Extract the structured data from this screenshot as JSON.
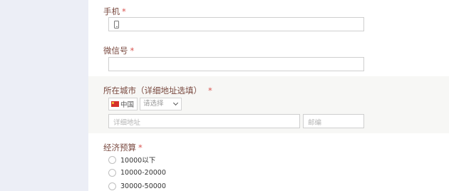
{
  "form": {
    "phone": {
      "label": "手机",
      "required_mark": "*",
      "icon": "mobile-phone-icon"
    },
    "wechat": {
      "label": "微信号",
      "required_mark": "*"
    },
    "city": {
      "label": "所在城市（详细地址选填）",
      "required_mark": "*",
      "country": "中国",
      "region_placeholder": "请选择",
      "address_placeholder": "详细地址",
      "zip_placeholder": "邮编"
    },
    "budget": {
      "label": "经济预算",
      "required_mark": "*",
      "options": [
        "10000以下",
        "10000-20000",
        "30000-50000"
      ]
    }
  }
}
